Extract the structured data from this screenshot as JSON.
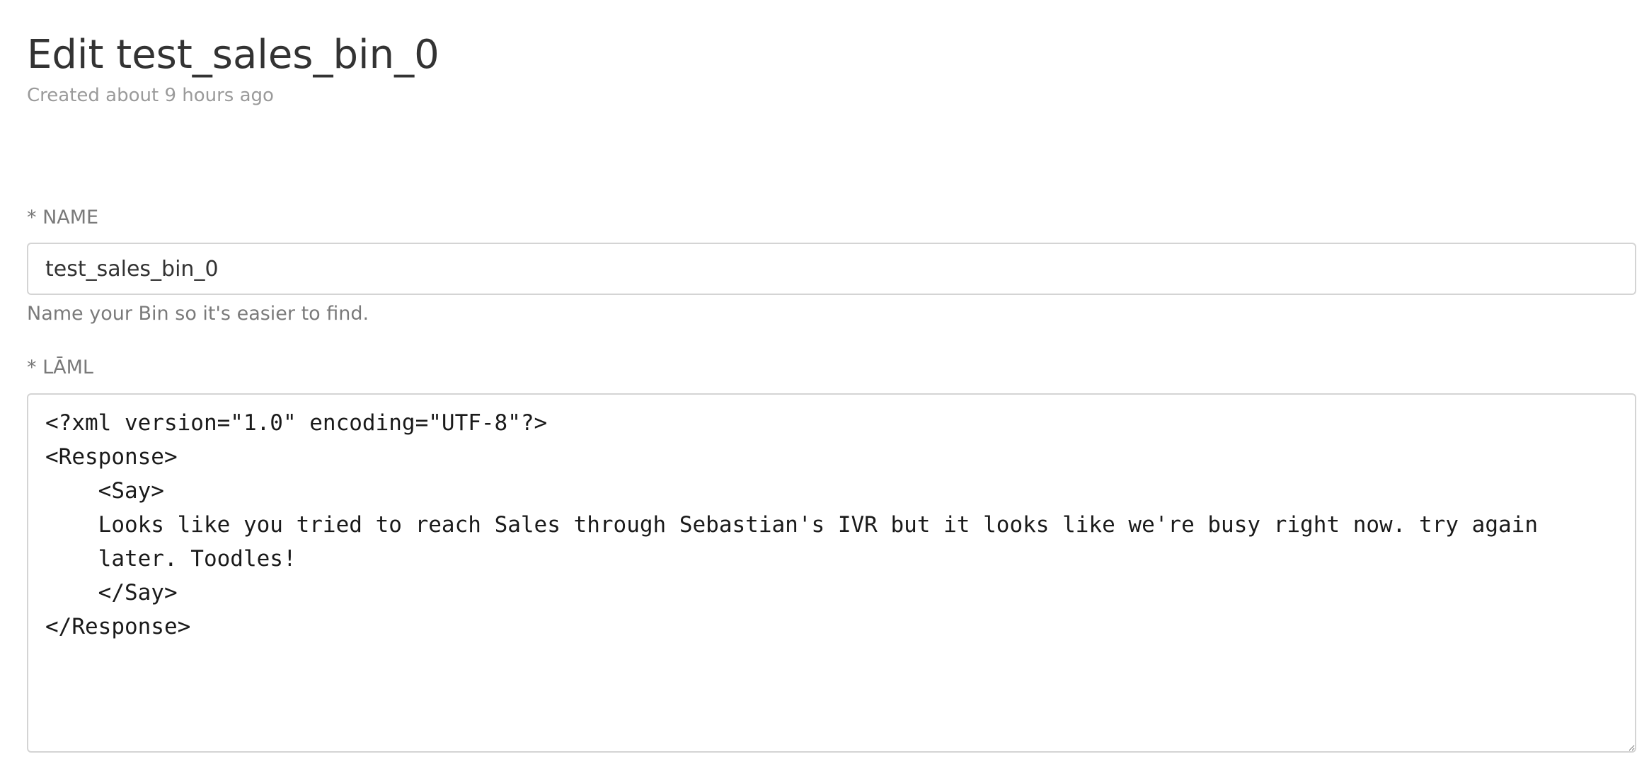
{
  "header": {
    "title": "Edit test_sales_bin_0",
    "subtitle": "Created about 9 hours ago"
  },
  "form": {
    "name_field": {
      "label": "* NAME",
      "value": "test_sales_bin_0",
      "help_text": "Name your Bin so it's easier to find."
    },
    "laml_field": {
      "label": "* LĀML",
      "value": "<?xml version=\"1.0\" encoding=\"UTF-8\"?>\n<Response>\n    <Say>\n    Looks like you tried to reach Sales through Sebastian's IVR but it looks like we're busy right now. try again\n    later. Toodles!\n    </Say>\n</Response>"
    }
  }
}
